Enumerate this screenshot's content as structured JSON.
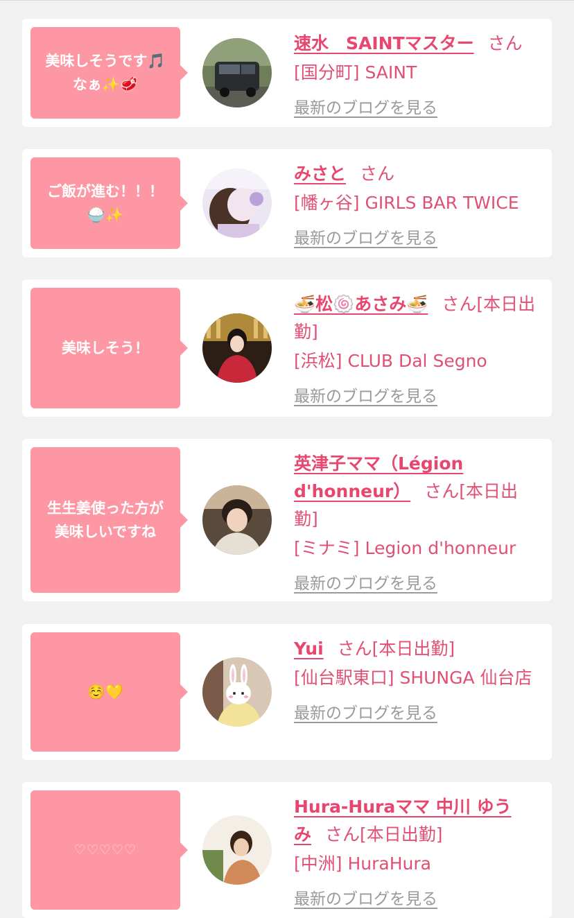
{
  "colors": {
    "bubble": "#fe97a4",
    "name": "#e8466e",
    "text": "#e05074",
    "blog_link": "#9a9a9a",
    "background": "#f1f1f1"
  },
  "comments": [
    {
      "bubble": "美味しそうです🎵\nなぁ✨🥩",
      "name": "速水　SAINTマスター",
      "honorific": "さん",
      "status": "",
      "shop": "[国分町] SAINT",
      "blog_link": "最新のブログを見る",
      "avatar_icon": "car-photo"
    },
    {
      "bubble": "ご飯が進む！！！\n🍚✨",
      "name": "みさと",
      "honorific": "さん",
      "status": "",
      "shop": "[幡ヶ谷] GIRLS BAR TWICE",
      "blog_link": "最新のブログを見る",
      "avatar_icon": "portrait-photo"
    },
    {
      "bubble": "美味しそう！",
      "name": "🍜松🍥あさみ🍜",
      "honorific": "さん",
      "status": "[本日出勤]",
      "shop": "[浜松] CLUB Dal Segno",
      "blog_link": "最新のブログを見る",
      "avatar_icon": "kimono-portrait-photo"
    },
    {
      "bubble": "生生姜使った方が\n美味しいですね",
      "name": "英津子ママ（Légion d'honneur）",
      "honorific": "さん",
      "status": "[本日出勤]",
      "shop": "[ミナミ] Legion d'honneur",
      "blog_link": "最新のブログを見る",
      "avatar_icon": "portrait-photo"
    },
    {
      "bubble": "☺️💛",
      "name": "Yui",
      "honorific": "さん",
      "status": "[本日出勤]",
      "shop": "[仙台駅東口] SHUNGA 仙台店",
      "blog_link": "最新のブログを見る",
      "avatar_icon": "bunny-face-portrait-photo"
    },
    {
      "bubble": "♡♡♡♡♡",
      "name": "Hura-Huraママ 中川 ゆうみ",
      "honorific": "さん",
      "status": "[本日出勤]",
      "shop": "[中洲] HuraHura",
      "blog_link": "最新のブログを見る",
      "avatar_icon": "portrait-photo"
    }
  ]
}
